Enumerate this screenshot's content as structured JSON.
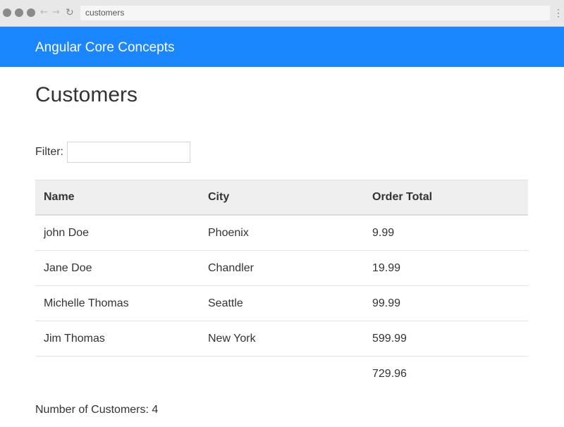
{
  "browser": {
    "url": "customers",
    "back_glyph": "←",
    "forward_glyph": "→",
    "reload_glyph": "↻",
    "menu_glyph": "⋮",
    "icons": [
      "window-control-icon",
      "back-arrow-icon",
      "forward-arrow-icon",
      "reload-icon",
      "menu-dots-icon"
    ]
  },
  "app": {
    "brand": "Angular Core Concepts",
    "brand_color": "#1a86ff"
  },
  "page": {
    "title": "Customers"
  },
  "filter": {
    "label": "Filter:",
    "value": ""
  },
  "table": {
    "columns": [
      "Name",
      "City",
      "Order Total"
    ],
    "rows": [
      [
        "john Doe",
        "Phoenix",
        "9.99"
      ],
      [
        "Jane Doe",
        "Chandler",
        "19.99"
      ],
      [
        "Michelle Thomas",
        "Seattle",
        "99.99"
      ],
      [
        "Jim Thomas",
        "New York",
        "599.99"
      ]
    ],
    "total": "729.96"
  },
  "footer": {
    "count_label": "Number of Customers:",
    "count_value": "4"
  }
}
